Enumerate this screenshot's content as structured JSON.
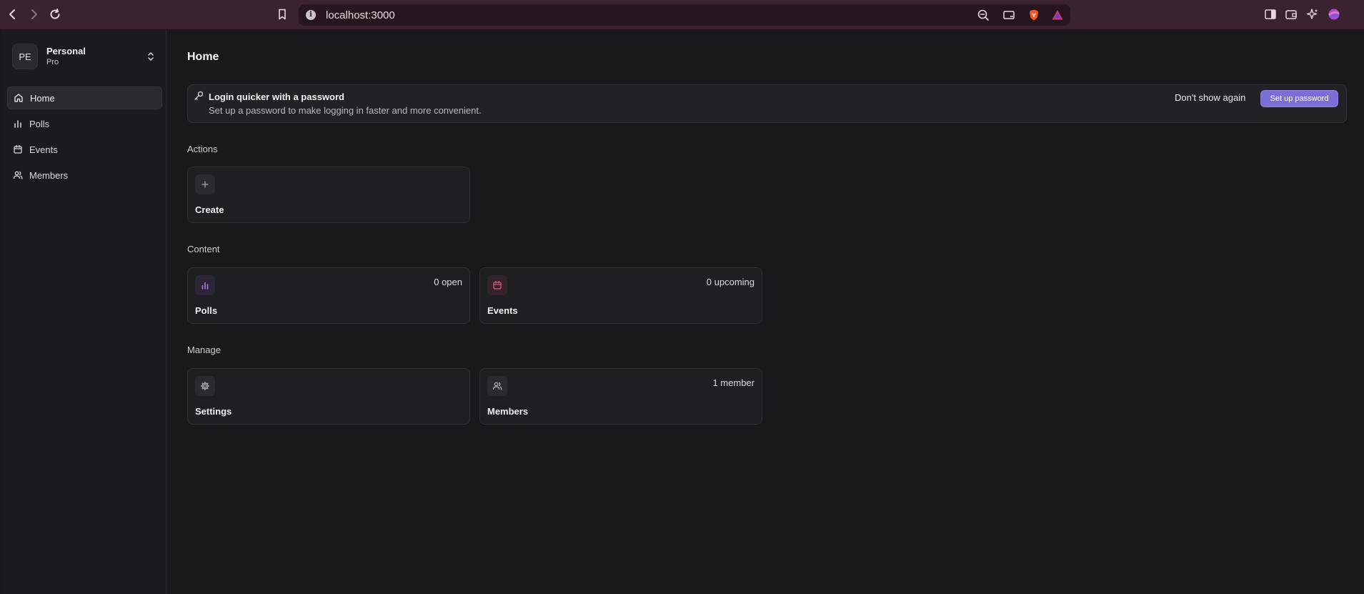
{
  "browser": {
    "url": "localhost:3000",
    "icons": [
      "back-icon",
      "forward-icon",
      "reload-icon",
      "bookmark-icon",
      "info-icon",
      "zoom-icon",
      "cast-icon",
      "brave-shield-icon",
      "brave-rewards-icon",
      "sidebar-toggle-icon",
      "wallet-icon",
      "leo-ai-icon",
      "profile-icon"
    ]
  },
  "sidebar": {
    "team": {
      "initials": "PE",
      "name": "Personal",
      "plan": "Pro"
    },
    "items": [
      {
        "label": "Home",
        "icon": "home-icon",
        "active": true
      },
      {
        "label": "Polls",
        "icon": "bar-chart-icon",
        "active": false
      },
      {
        "label": "Events",
        "icon": "calendar-icon",
        "active": false
      },
      {
        "label": "Members",
        "icon": "users-icon",
        "active": false
      }
    ]
  },
  "main": {
    "title": "Home",
    "banner": {
      "title": "Login quicker with a password",
      "description": "Set up a password to make logging in faster and more convenient.",
      "dismiss_label": "Don't show again",
      "action_label": "Set up password"
    },
    "sections": {
      "actions": "Actions",
      "content": "Content",
      "manage": "Manage"
    },
    "cards": {
      "create": {
        "label": "Create",
        "icon": "plus-icon"
      },
      "polls": {
        "label": "Polls",
        "count": "0 open",
        "icon": "bar-chart-icon"
      },
      "events": {
        "label": "Events",
        "count": "0 upcoming",
        "icon": "calendar-icon"
      },
      "settings": {
        "label": "Settings",
        "icon": "gear-icon"
      },
      "members": {
        "label": "Members",
        "count": "1 member",
        "icon": "users-icon"
      }
    }
  },
  "colors": {
    "accent": "#7b6ed6",
    "polls_icon": "#a77be0",
    "events_icon": "#e0587a",
    "background": "#19181b"
  }
}
